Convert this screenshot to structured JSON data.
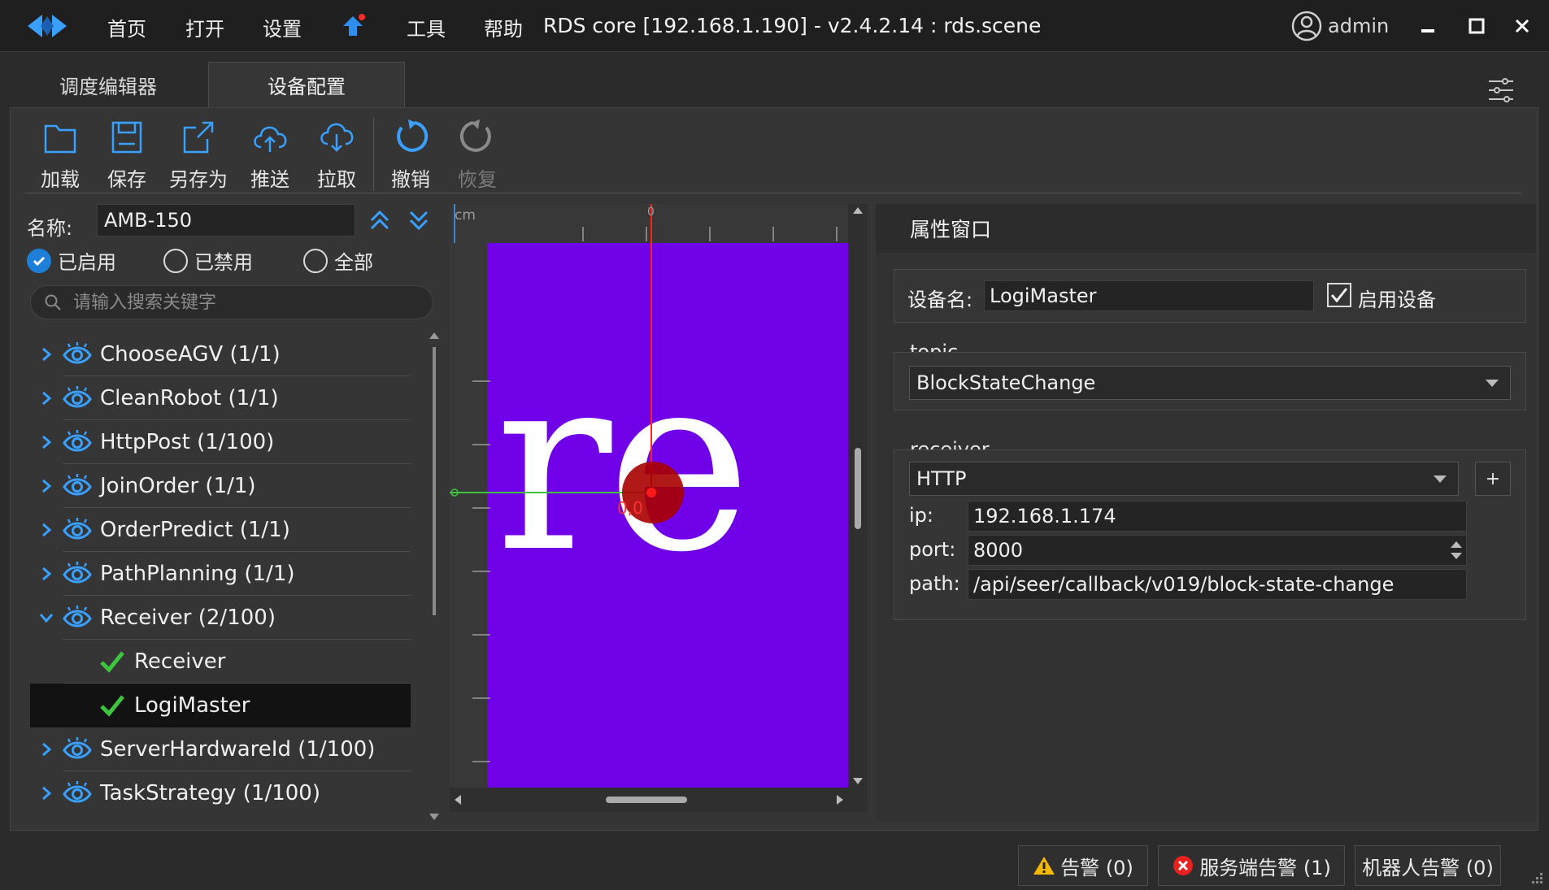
{
  "titlebar": {
    "menu": [
      "首页",
      "打开",
      "设置",
      "工具",
      "帮助"
    ],
    "title": "RDS core [192.168.1.190] - v2.4.2.14 : rds.scene",
    "user": "admin",
    "icons": [
      "app-logo-icon",
      "upload-arrow-icon",
      "user-icon",
      "minimize-icon",
      "maximize-icon",
      "close-icon"
    ]
  },
  "tabs": [
    {
      "label": "调度编辑器",
      "active": false
    },
    {
      "label": "设备配置",
      "active": true
    }
  ],
  "toolbar": {
    "load": "加载",
    "save": "保存",
    "save_as": "另存为",
    "push": "推送",
    "pull": "拉取",
    "undo": "撤销",
    "redo": "恢复"
  },
  "left": {
    "name_label": "名称:",
    "name_value": "AMB-150",
    "filters": {
      "enabled": "已启用",
      "disabled": "已禁用",
      "all": "全部",
      "selected": "enabled"
    },
    "search_placeholder": "请输入搜索关键字",
    "tree": [
      {
        "label": "ChooseAGV (1/1)",
        "expanded": false
      },
      {
        "label": "CleanRobot (1/1)",
        "expanded": false
      },
      {
        "label": "HttpPost (1/100)",
        "expanded": false
      },
      {
        "label": "JoinOrder (1/1)",
        "expanded": false
      },
      {
        "label": "OrderPredict (1/1)",
        "expanded": false
      },
      {
        "label": "PathPlanning (1/1)",
        "expanded": false
      },
      {
        "label": "Receiver (2/100)",
        "expanded": true
      },
      {
        "label": "Receiver",
        "child": true
      },
      {
        "label": "LogiMaster",
        "child": true,
        "selected": true
      },
      {
        "label": "ServerHardwareId (1/100)",
        "expanded": false
      },
      {
        "label": "TaskStrategy (1/100)",
        "expanded": false
      }
    ]
  },
  "canvas": {
    "unit": "cm",
    "origin_label": "0",
    "origin_coord": "0,0",
    "big_text": "re",
    "bg_color": "#6f00e8"
  },
  "properties": {
    "header": "属性窗口",
    "device_name_label": "设备名:",
    "device_name": "LogiMaster",
    "enable_label": "启用设备",
    "enabled": true,
    "topic_label": "topic",
    "topic_value": "BlockStateChange",
    "receiver_label": "receiver",
    "receiver_type": "HTTP",
    "add_label": "+",
    "ip_label": "ip:",
    "ip_value": "192.168.1.174",
    "port_label": "port:",
    "port_value": "8000",
    "path_label": "path:",
    "path_value": "/api/seer/callback/v019/block-state-change"
  },
  "status": {
    "alarm": "告警 (0)",
    "server_alarm": "服务端告警 (1)",
    "robot_alarm": "机器人告警 (0)"
  }
}
